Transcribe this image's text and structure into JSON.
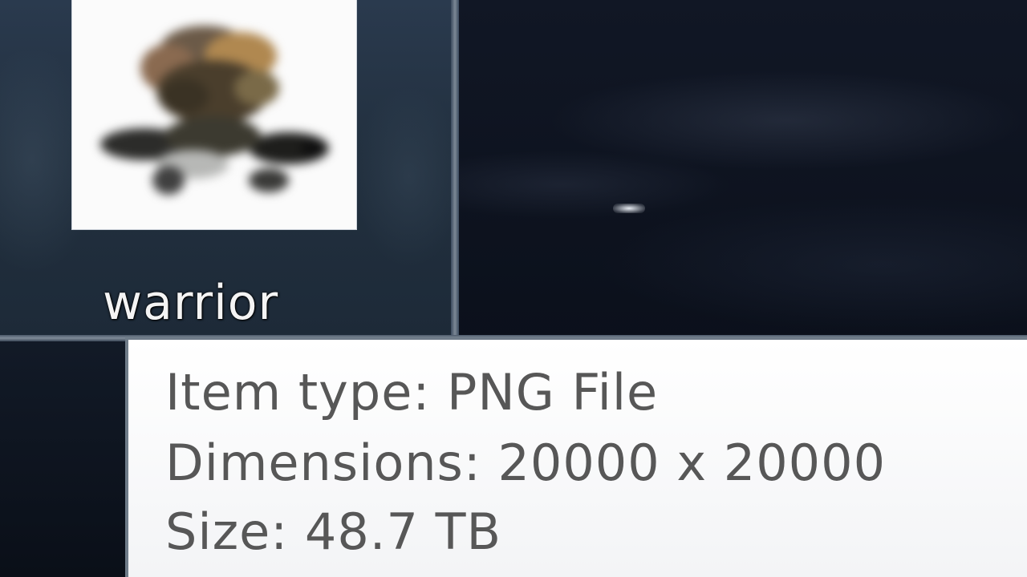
{
  "file": {
    "name": "warrior",
    "thumbnail_icon": "warrior-image-thumbnail"
  },
  "tooltip": {
    "lines": [
      "Item type: PNG File",
      "Dimensions: 20000 x 20000",
      "Size: 48.7 TB"
    ]
  },
  "colors": {
    "tooltip_background": "#ffffff",
    "tooltip_text": "#575757",
    "desktop_background": "#0d1320",
    "panel_background": "#22303f"
  }
}
